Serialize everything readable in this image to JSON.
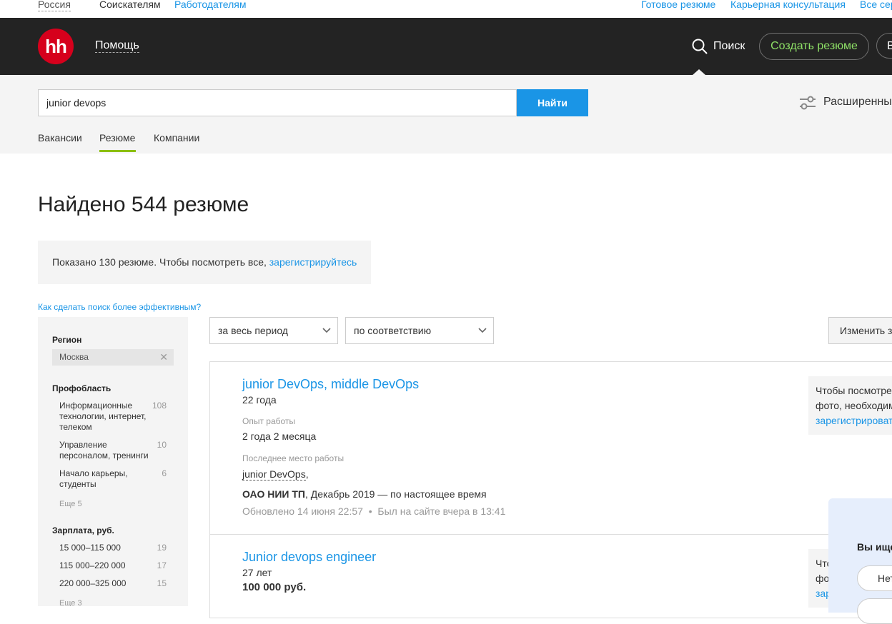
{
  "topbar": {
    "region": "Россия",
    "seekers": "Соискателям",
    "employers": "Работодателям",
    "ready_resume": "Готовое резюме",
    "career_consult": "Карьерная консультация",
    "all_services": "Все сер"
  },
  "header": {
    "logo": "hh",
    "help": "Помощь",
    "search": "Поиск",
    "create_resume": "Создать резюме",
    "login_partial": "В"
  },
  "search": {
    "query": "junior devops",
    "find_button": "Найти",
    "advanced": "Расширенны",
    "tabs": [
      "Вакансии",
      "Резюме",
      "Компании"
    ],
    "active_tab": "Резюме"
  },
  "main": {
    "found_title": "Найдено 544 резюме",
    "notice_text": "Показано 130 резюме. Чтобы посмотреть все, ",
    "notice_link": "зарегистрируйтесь",
    "howto_link": "Как сделать поиск более эффективным?"
  },
  "sidebar": {
    "region_title": "Регион",
    "region_value": "Москва",
    "prof_title": "Профобласть",
    "prof_items": [
      {
        "label": "Информационные технологии, интернет, телеком",
        "count": "108"
      },
      {
        "label": "Управление персоналом, тренинги",
        "count": "10"
      },
      {
        "label": "Начало карьеры, студенты",
        "count": "6"
      }
    ],
    "prof_more": "Еще 5",
    "salary_title": "Зарплата, руб.",
    "salary_items": [
      {
        "label": "15 000–115 000",
        "count": "19"
      },
      {
        "label": "115 000–220 000",
        "count": "17"
      },
      {
        "label": "220 000–325 000",
        "count": "15"
      }
    ],
    "salary_more": "Еще 3"
  },
  "filters": {
    "period": "за весь период",
    "sort": "по соответствию",
    "change": "Изменить з"
  },
  "results": [
    {
      "title": "junior DevOps, middle DevOps",
      "age": "22 года",
      "exp_label": "Опыт работы",
      "exp_value": "2 года 2 месяца",
      "last_label": "Последнее место работы",
      "last_position": "junior DevOps",
      "company": "ОАО НИИ ТП",
      "period": ", Декабрь 2019 — по настоящее время",
      "updated": "Обновлено 14 июня 22:57",
      "online": "Был на сайте вчера в 13:41",
      "side_line1": "Чтобы посмотре",
      "side_line2": "фото, необходим",
      "side_link": "зарегистрироват"
    },
    {
      "title": "Junior devops engineer",
      "age": "27 лет",
      "salary": "100 000 руб.",
      "side_line1": "Что",
      "side_line2": "фо",
      "side_link": "зар"
    }
  ],
  "popup": {
    "title": "Вы ище",
    "button": "Нет"
  }
}
